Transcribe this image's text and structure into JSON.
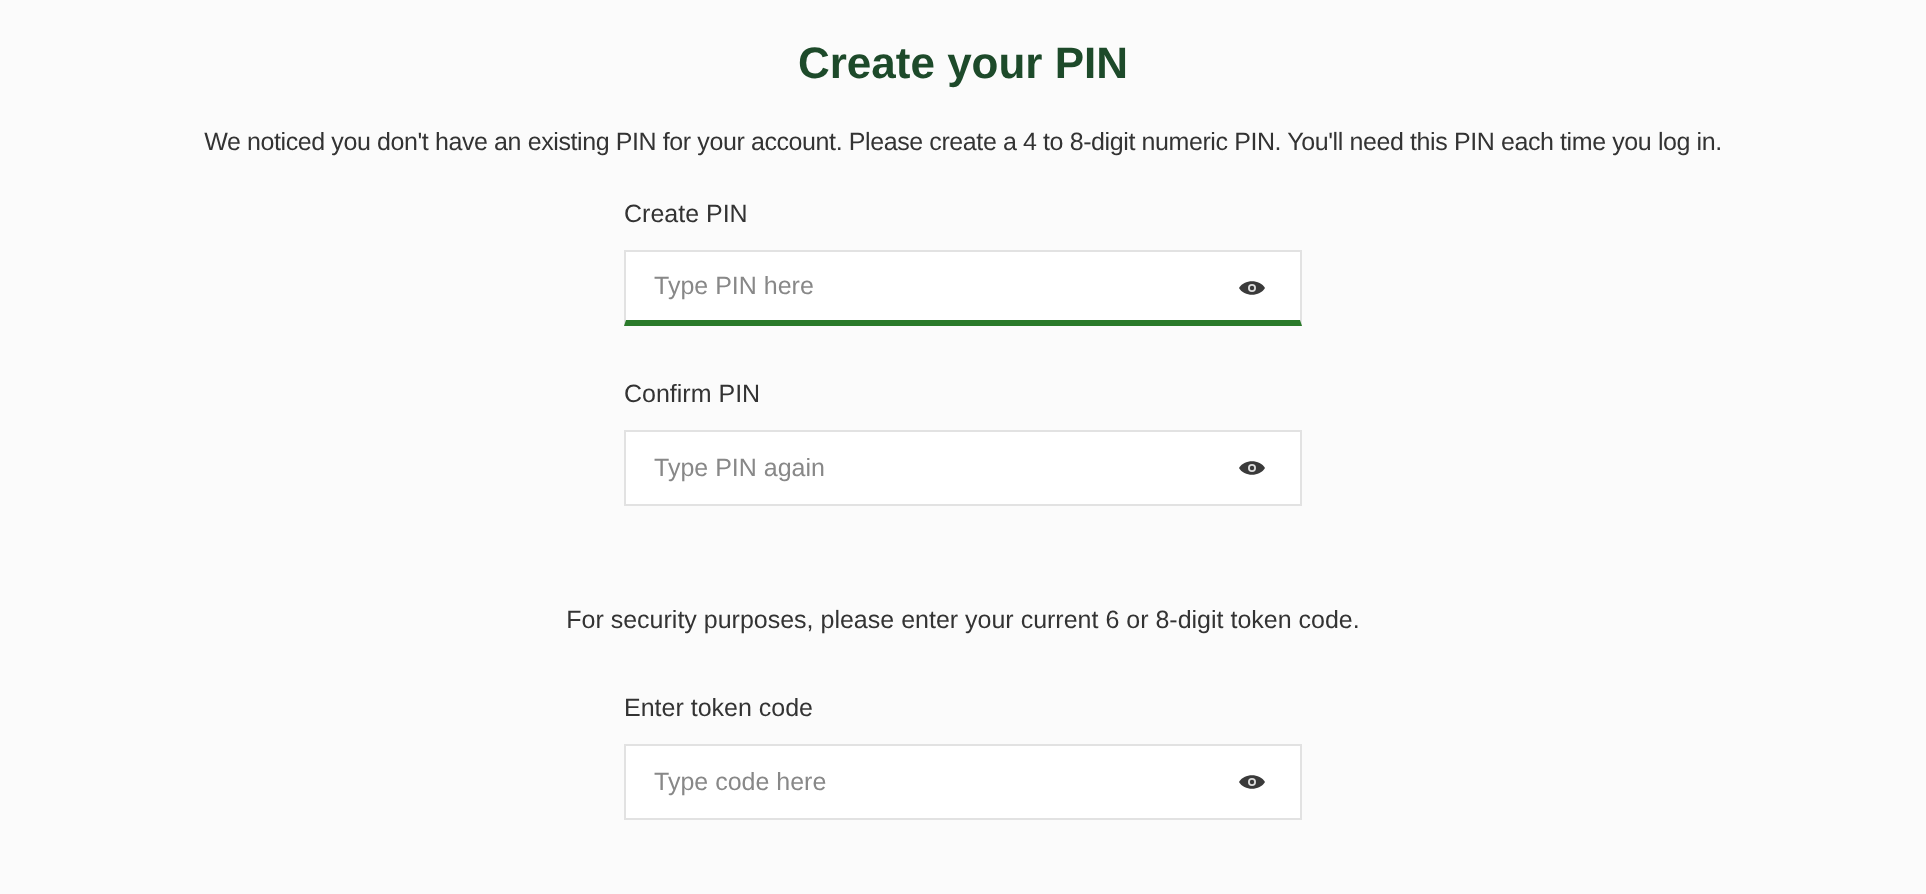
{
  "title": "Create your PIN",
  "intro": "We noticed you don't have an existing PIN for your account. Please create a 4 to 8-digit numeric PIN. You'll need this PIN each time you log in.",
  "pin_fields": [
    {
      "label": "Create PIN",
      "placeholder": "Type PIN here",
      "focused": true
    },
    {
      "label": "Confirm PIN",
      "placeholder": "Type PIN again",
      "focused": false
    }
  ],
  "security_note": "For security purposes, please enter your current 6 or 8-digit token code.",
  "token_field": {
    "label": "Enter token code",
    "placeholder": "Type code here",
    "focused": false
  }
}
